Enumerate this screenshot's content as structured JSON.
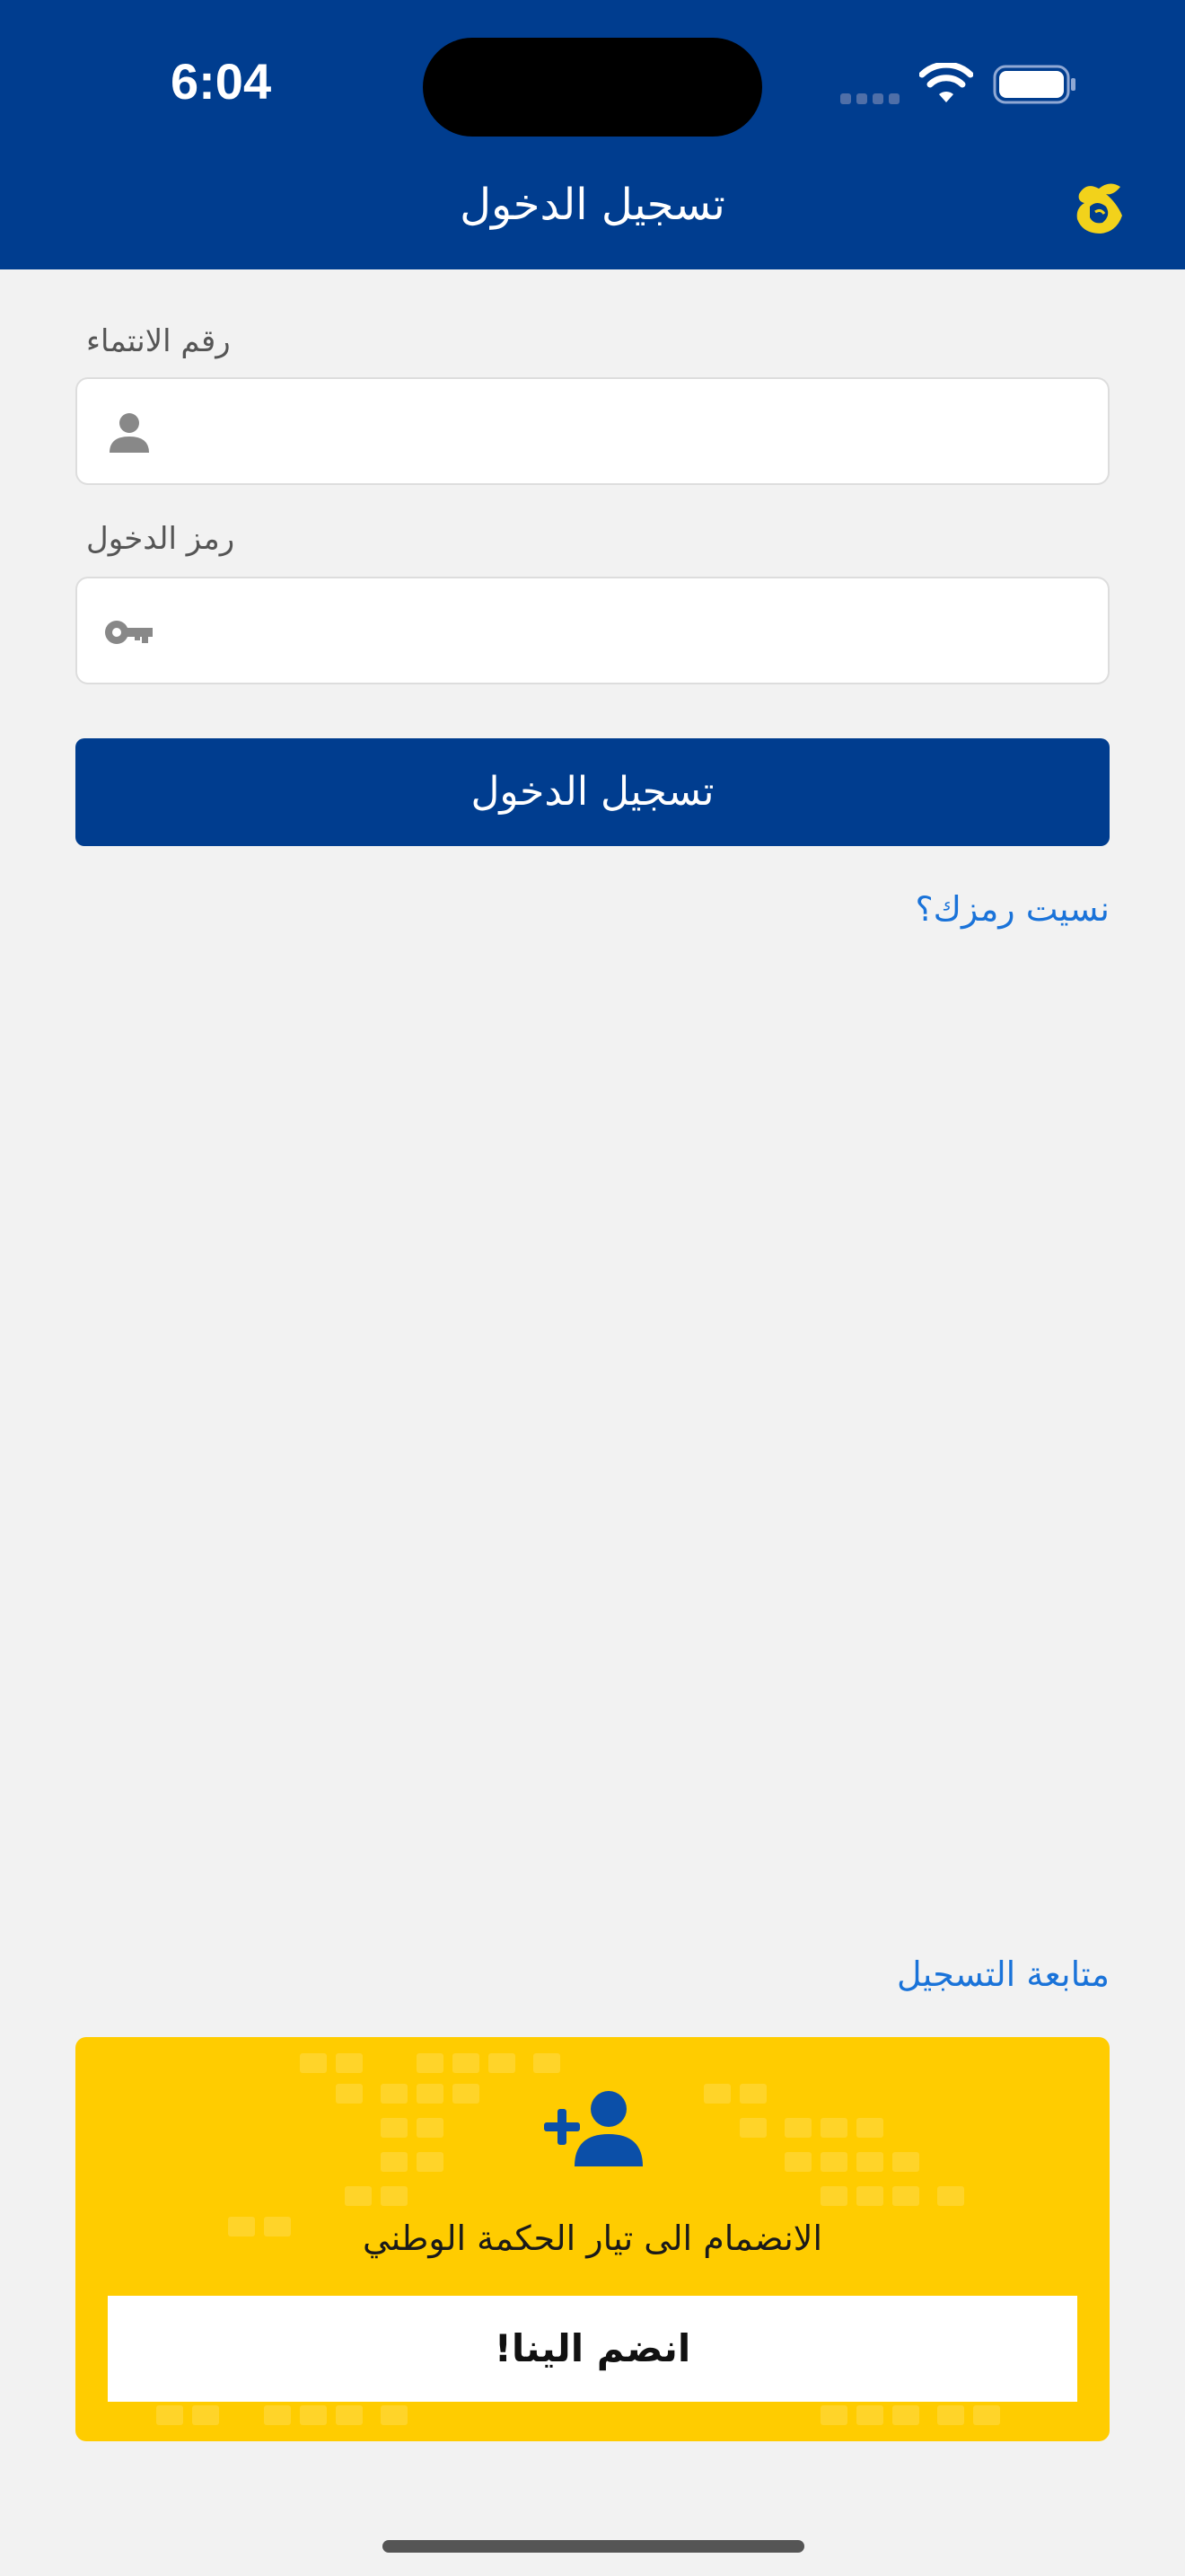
{
  "status_bar": {
    "time": "6:04",
    "icons": [
      "cellular-icon",
      "wifi-icon",
      "battery-icon"
    ]
  },
  "header": {
    "title": "تسجيل الدخول",
    "logo": "logo-icon"
  },
  "form": {
    "membership_label": "رقم الانتماء",
    "membership_value": "",
    "password_label": "رمز الدخول",
    "password_value": "",
    "login_button": "تسجيل الدخول",
    "forgot_link": "نسيت رمزك؟"
  },
  "registration": {
    "continue_link": "متابعة التسجيل",
    "join_text": "الانضمام الى تيار الحكمة الوطني",
    "join_button": "انضم الينا!"
  },
  "colors": {
    "primary": "#003d8f",
    "link": "#1a73d9",
    "card": "#ffcc00",
    "background": "#f2f2f2"
  }
}
